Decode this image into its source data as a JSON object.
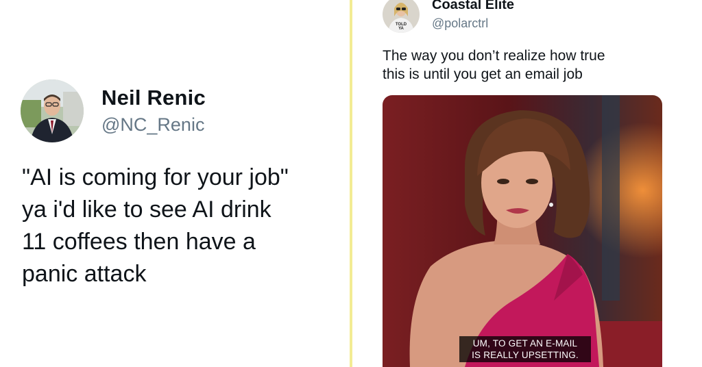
{
  "left_tweet": {
    "name": "Neil Renic",
    "handle": "@NC_Renic",
    "text_lines": [
      "\"AI is coming for your job\"",
      "ya i'd like to see AI drink",
      "11 coffees then have a",
      "panic attack"
    ]
  },
  "right_tweet": {
    "name": "Coastal Elite",
    "handle": "@polarctrl",
    "avatar_shirt_text": [
      "TOLD",
      "YA"
    ],
    "text_lines": [
      "The way you don’t realize how true",
      "this is until you get an email job"
    ],
    "media_subtitle_lines": [
      "UM, TO GET AN E-MAIL",
      "IS REALLY UPSETTING."
    ]
  },
  "colors": {
    "divider": "#f3ec94",
    "handle_gray": "#657786",
    "dress_magenta": "#c2185b"
  }
}
